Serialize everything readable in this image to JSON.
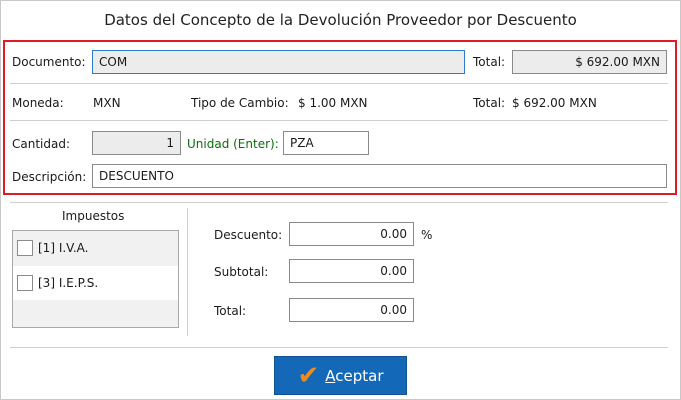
{
  "window": {
    "title": "Datos del Concepto de la Devolución Proveedor por Descuento"
  },
  "documento": {
    "label": "Documento:",
    "value": "COM"
  },
  "total_top": {
    "label": "Total:",
    "value": "$ 692.00 MXN"
  },
  "moneda": {
    "label": "Moneda:",
    "value": "MXN"
  },
  "tipo_cambio": {
    "label": "Tipo de Cambio:",
    "value": "$ 1.00 MXN"
  },
  "total_info": {
    "label": "Total:",
    "value": "$ 692.00 MXN"
  },
  "cantidad": {
    "label": "Cantidad:",
    "value": "1"
  },
  "unidad": {
    "label": "Unidad (Enter):",
    "value": "PZA"
  },
  "descripcion": {
    "label": "Descripción:",
    "value": "DESCUENTO"
  },
  "impuestos": {
    "title": "Impuestos",
    "items": [
      {
        "code": "[1]",
        "name": "I.V.A.",
        "checked": false
      },
      {
        "code": "[3]",
        "name": "I.E.P.S.",
        "checked": false
      }
    ]
  },
  "descuento": {
    "label": "Descuento:",
    "value": "0.00",
    "unit": "%"
  },
  "subtotal": {
    "label": "Subtotal:",
    "value": "0.00"
  },
  "total_bottom": {
    "label": "Total:",
    "value": "0.00"
  },
  "accept_button": {
    "accel": "A",
    "rest": "ceptar"
  },
  "colors": {
    "accent_red": "#e11b22",
    "button_blue": "#1468b8",
    "check_orange": "#f08a1c",
    "label_green": "#0b6e0b"
  }
}
